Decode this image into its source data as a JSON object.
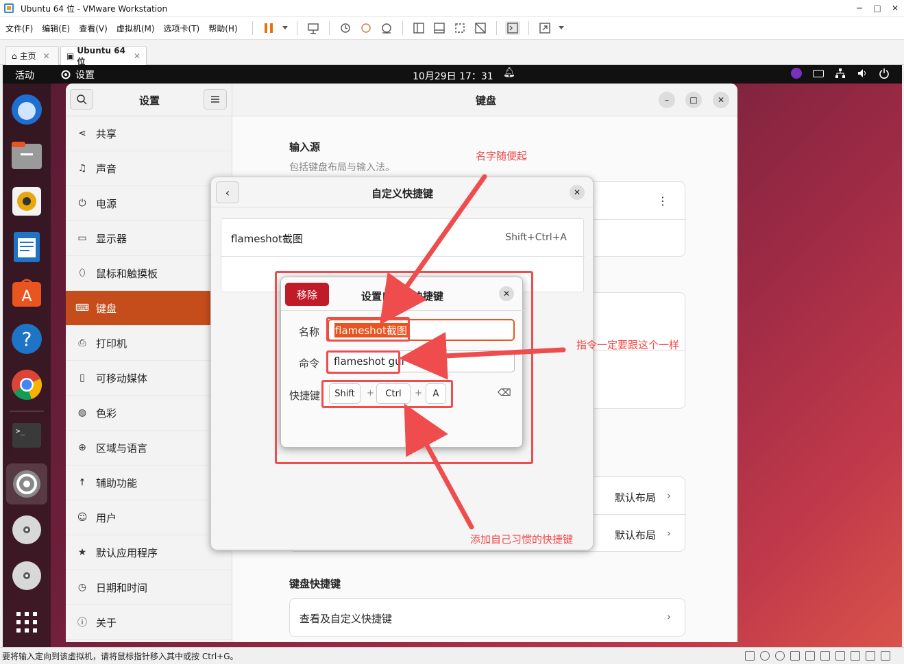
{
  "vmware": {
    "title": "Ubuntu 64 位 - VMware Workstation",
    "menus": [
      "文件(F)",
      "编辑(E)",
      "查看(V)",
      "虚拟机(M)",
      "选项卡(T)",
      "帮助(H)"
    ],
    "tabs": [
      {
        "label": "主页"
      },
      {
        "label": "Ubuntu 64 位"
      }
    ],
    "status_text": "要将输入定向到该虚拟机，请将鼠标指针移入其中或按 Ctrl+G。"
  },
  "ubuntu": {
    "activities": "活动",
    "app_name": "设置",
    "clock": "10月29日  17：31"
  },
  "settings": {
    "sidebar_title": "设置",
    "main_title": "键盘",
    "sidebar_items": [
      {
        "label": "共享",
        "icon": "share-icon"
      },
      {
        "label": "声音",
        "icon": "music-note-icon"
      },
      {
        "label": "电源",
        "icon": "power-icon"
      },
      {
        "label": "显示器",
        "icon": "display-icon"
      },
      {
        "label": "鼠标和触摸板",
        "icon": "mouse-icon"
      },
      {
        "label": "键盘",
        "icon": "keyboard-icon"
      },
      {
        "label": "打印机",
        "icon": "printer-icon"
      },
      {
        "label": "可移动媒体",
        "icon": "removable-media-icon"
      },
      {
        "label": "色彩",
        "icon": "color-icon"
      },
      {
        "label": "区域与语言",
        "icon": "globe-icon"
      },
      {
        "label": "辅助功能",
        "icon": "accessibility-icon"
      },
      {
        "label": "用户",
        "icon": "users-icon"
      },
      {
        "label": "默认应用程序",
        "icon": "star-icon"
      },
      {
        "label": "日期和时间",
        "icon": "clock-icon"
      },
      {
        "label": "关于",
        "icon": "info-icon"
      }
    ],
    "input_source_title": "输入源",
    "input_source_sub": "包括键盘布局与输入法。",
    "default_layout_1": "默认布局",
    "default_layout_2": "默认布局",
    "kbd_shortcuts_title": "键盘快捷键",
    "view_custom_shortcuts": "查看及自定义快捷键"
  },
  "custom_shortcuts_dialog": {
    "title": "自定义快捷键",
    "entry_name": "flameshot截图",
    "entry_accel": "Shift+Ctrl+A"
  },
  "set_shortcut_dialog": {
    "remove_label": "移除",
    "title": "设置自定义快捷键",
    "name_label": "名称",
    "name_value": "flameshot截图",
    "command_label": "命令",
    "command_value": "flameshot gui",
    "shortcut_label": "快捷键",
    "keys": [
      "Shift",
      "Ctrl",
      "A"
    ],
    "plus": "+"
  },
  "annotations": {
    "name_note": "名字随便起",
    "command_note": "指令一定要跟这个一样",
    "shortcut_note": "添加自己习惯的快捷键",
    "color": "#f04848"
  }
}
